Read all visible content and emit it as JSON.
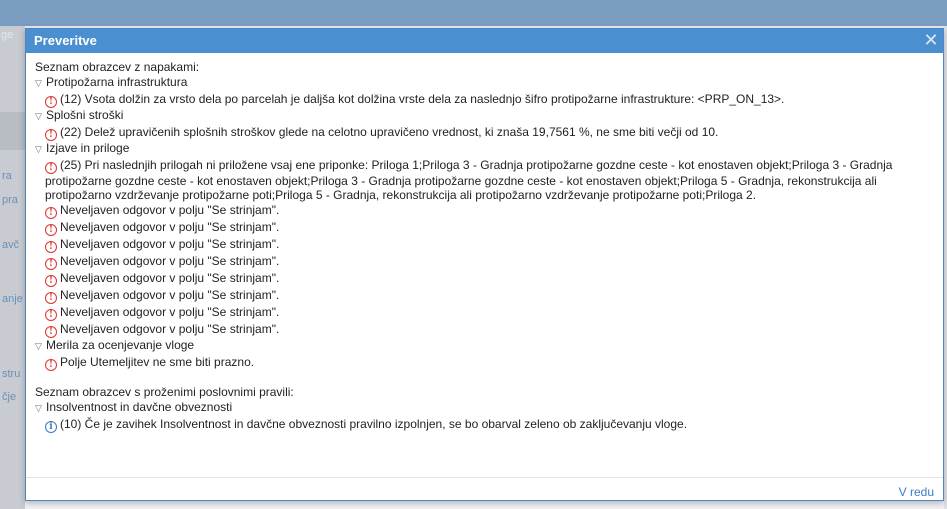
{
  "background": {
    "fragments": [
      "ge",
      "ra",
      "pra",
      "avč",
      "anje",
      "stru",
      "čje"
    ]
  },
  "dialog": {
    "title": "Preveritve",
    "close_glyph": "✕",
    "ok_label": "V redu",
    "sections": [
      {
        "heading": "Seznam obrazcev z napakami:",
        "groups": [
          {
            "name": "Protipožarna infrastruktura",
            "messages": [
              {
                "type": "error",
                "text": "(12) Vsota dolžin za vrsto dela po parcelah je daljša kot dolžina vrste dela za naslednjo šifro protipožarne infrastrukture: <PRP_ON_13>."
              }
            ]
          },
          {
            "name": "Splošni stroški",
            "messages": [
              {
                "type": "error",
                "text": "(22) Delež upravičenih splošnih stroškov glede na celotno upravičeno vrednost, ki znaša 19,7561 %, ne sme biti večji od 10."
              }
            ]
          },
          {
            "name": "Izjave in priloge",
            "messages": [
              {
                "type": "error",
                "text": "(25) Pri naslednjih prilogah ni priložene vsaj ene priponke: Priloga 1;Priloga 3 - Gradnja protipožarne gozdne ceste - kot enostaven objekt;Priloga 3 - Gradnja protipožarne gozdne ceste - kot enostaven objekt;Priloga 3 - Gradnja protipožarne gozdne ceste - kot enostaven objekt;Priloga 5 - Gradnja, rekonstrukcija ali protipožarno vzdrževanje protipožarne poti;Priloga 5 - Gradnja, rekonstrukcija ali protipožarno vzdrževanje protipožarne poti;Priloga 2."
              },
              {
                "type": "error",
                "text": "Neveljaven odgovor v polju \"Se strinjam\"."
              },
              {
                "type": "error",
                "text": "Neveljaven odgovor v polju \"Se strinjam\"."
              },
              {
                "type": "error",
                "text": "Neveljaven odgovor v polju \"Se strinjam\"."
              },
              {
                "type": "error",
                "text": "Neveljaven odgovor v polju \"Se strinjam\"."
              },
              {
                "type": "error",
                "text": "Neveljaven odgovor v polju \"Se strinjam\"."
              },
              {
                "type": "error",
                "text": "Neveljaven odgovor v polju \"Se strinjam\"."
              },
              {
                "type": "error",
                "text": "Neveljaven odgovor v polju \"Se strinjam\"."
              },
              {
                "type": "error",
                "text": "Neveljaven odgovor v polju \"Se strinjam\"."
              }
            ]
          },
          {
            "name": "Merila za ocenjevanje vloge",
            "messages": [
              {
                "type": "error",
                "text": "Polje Utemeljitev ne sme biti prazno."
              }
            ]
          }
        ]
      },
      {
        "heading": "Seznam obrazcev s proženimi poslovnimi pravili:",
        "groups": [
          {
            "name": "Insolventnost in davčne obveznosti",
            "messages": [
              {
                "type": "info",
                "text": "(10) Če je zavihek Insolventnost in davčne obveznosti pravilno izpolnjen, se bo obarval zeleno ob zaključevanju vloge."
              }
            ]
          }
        ]
      }
    ]
  },
  "icons": {
    "error": "error-circle-icon",
    "info": "info-circle-icon",
    "expanded": "triangle-down-icon"
  },
  "colors": {
    "titlebar": "#4a8fd0",
    "error": "#e0342f",
    "info": "#3a7bc8",
    "link": "#3a7bc8"
  }
}
